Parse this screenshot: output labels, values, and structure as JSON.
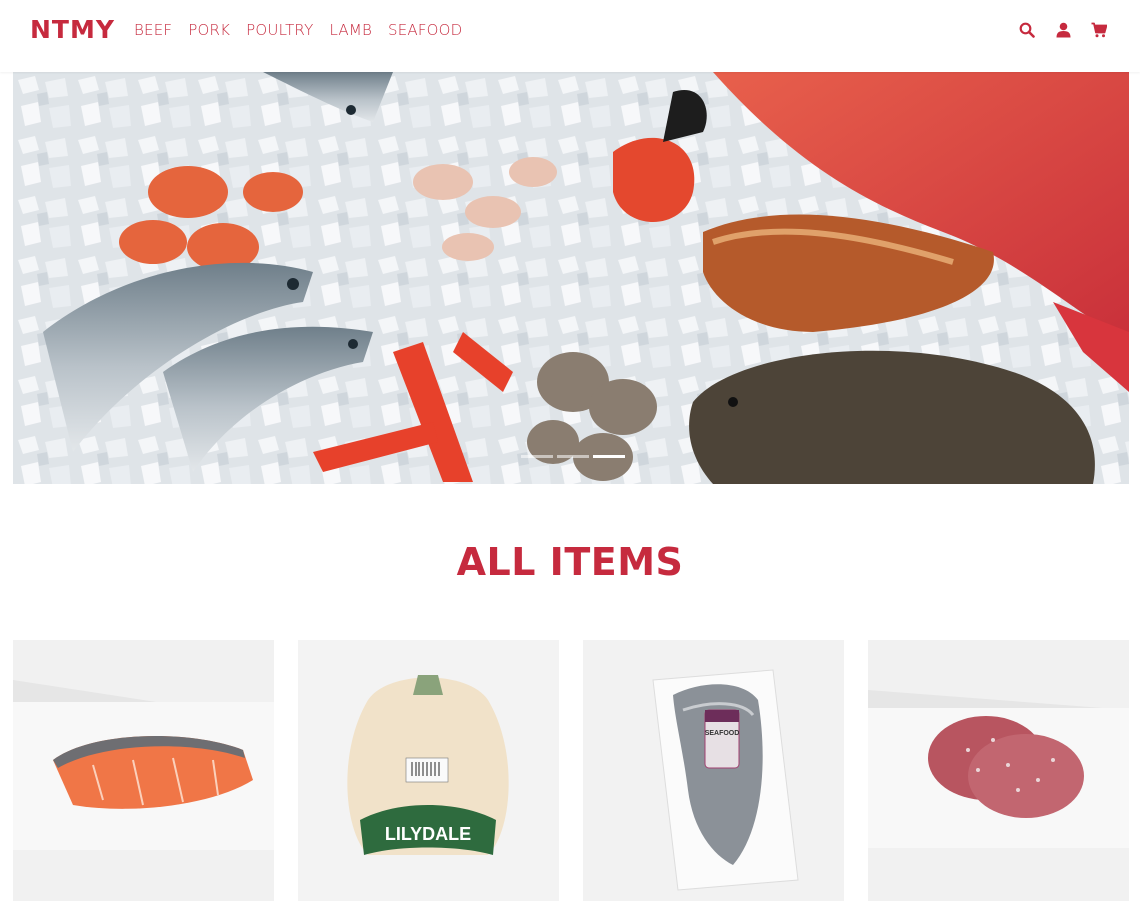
{
  "brand": {
    "name": "NTMY",
    "accent": "#c62a3e"
  },
  "nav": {
    "items": [
      {
        "label": "BEEF"
      },
      {
        "label": "PORK"
      },
      {
        "label": "POULTRY"
      },
      {
        "label": "LAMB"
      },
      {
        "label": "SEAFOOD"
      }
    ],
    "icons": [
      "search-icon",
      "user-icon",
      "cart-icon"
    ]
  },
  "hero": {
    "slides": 3,
    "active_slide": 3
  },
  "section": {
    "title": "ALL ITEMS"
  },
  "products": [
    {
      "name": "salmon-fillet"
    },
    {
      "name": "whole-chicken",
      "package_text": "LILYDALE"
    },
    {
      "name": "vacuum-packed-fish-fillet",
      "package_text": "SEAFOOD"
    },
    {
      "name": "beef-burger-patties"
    }
  ]
}
